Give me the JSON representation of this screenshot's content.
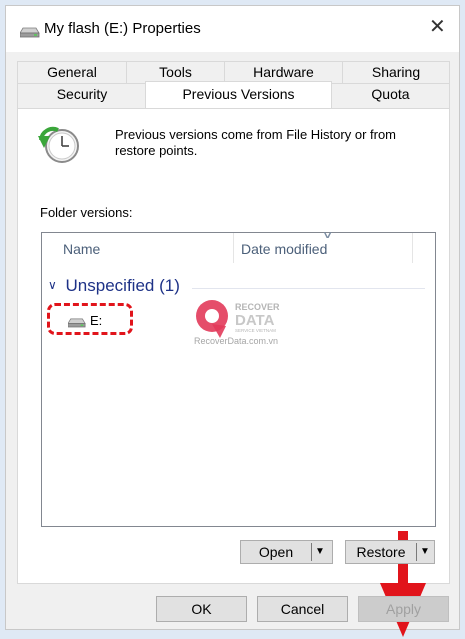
{
  "window": {
    "title": "My flash (E:) Properties",
    "close_glyph": "✕",
    "title_icon": "drive-icon"
  },
  "tabs": {
    "row1": [
      "General",
      "Tools",
      "Hardware",
      "Sharing"
    ],
    "row2": [
      "Security",
      "Previous Versions",
      "Quota"
    ],
    "active": "Previous Versions"
  },
  "panel": {
    "info_text": "Previous versions come from File History or from restore points.",
    "icon": "previous-versions-clock-icon",
    "folder_versions_label": "Folder versions:"
  },
  "listview": {
    "columns": [
      "Name",
      "Date modified"
    ],
    "groups": [
      {
        "header": "Unspecified (1)",
        "items": [
          {
            "name": "E:",
            "icon": "drive-icon",
            "date_modified": ""
          }
        ]
      }
    ]
  },
  "watermark": {
    "line1": "RECOVER",
    "line2": "DATA",
    "line3": "SERVICE VIETNAM",
    "url": "RecoverData.com.vn"
  },
  "actions": {
    "open_label": "Open",
    "restore_label": "Restore"
  },
  "footer": {
    "ok_label": "OK",
    "cancel_label": "Cancel",
    "apply_label": "Apply"
  },
  "colors": {
    "annotation_red": "#e1141b",
    "group_header_blue": "#1e3287",
    "watermark_pink": "#e23a5a",
    "background": "#dfe9f5"
  }
}
